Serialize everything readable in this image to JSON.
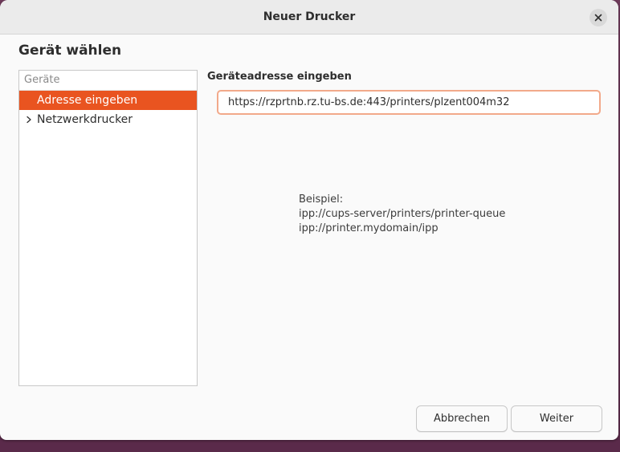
{
  "window": {
    "title": "Neuer Drucker"
  },
  "page": {
    "heading": "Gerät wählen"
  },
  "devices": {
    "header": "Geräte",
    "items": [
      {
        "label": "Adresse eingeben",
        "selected": true,
        "expandable": false
      },
      {
        "label": "Netzwerkdrucker",
        "selected": false,
        "expandable": true
      }
    ]
  },
  "address": {
    "label": "Geräteadresse eingeben",
    "value": "https://rzprtnb.rz.tu-bs.de:443/printers/plzent004m32",
    "example_title": "Beispiel:",
    "example_1": "ipp://cups-server/printers/printer-queue",
    "example_2": "ipp://printer.mydomain/ipp"
  },
  "buttons": {
    "cancel": "Abbrechen",
    "next": "Weiter"
  },
  "colors": {
    "accent": "#e95420",
    "focus_border": "#f2a98a"
  }
}
